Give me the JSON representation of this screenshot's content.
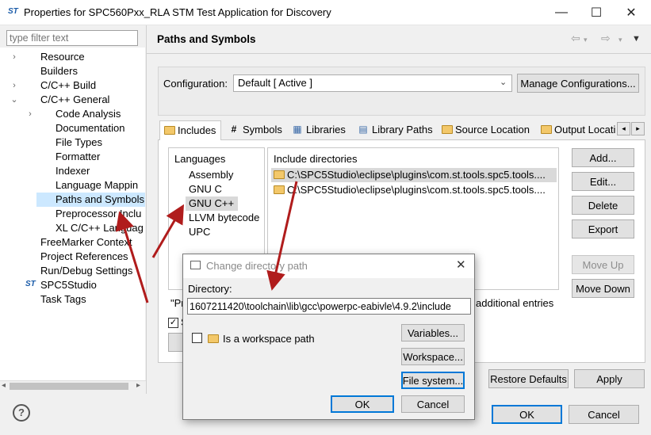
{
  "window": {
    "icon_text": "ST",
    "title": "Properties for SPC560Pxx_RLA STM Test Application for Discovery",
    "minimize": "—",
    "maximize": "☐",
    "close": "✕"
  },
  "filter": {
    "placeholder": "type filter text"
  },
  "nav": {
    "items": [
      {
        "label": "Resource"
      },
      {
        "label": "Builders"
      },
      {
        "label": "C/C++ Build"
      },
      {
        "label": "C/C++ General"
      },
      {
        "label": "Code Analysis"
      },
      {
        "label": "Documentation"
      },
      {
        "label": "File Types"
      },
      {
        "label": "Formatter"
      },
      {
        "label": "Indexer"
      },
      {
        "label": "Language Mappin"
      },
      {
        "label": "Paths and Symbols"
      },
      {
        "label": "Preprocessor Inclu"
      },
      {
        "label": "XL C/C++ Languag"
      },
      {
        "label": "FreeMarker Context"
      },
      {
        "label": "Project References"
      },
      {
        "label": "Run/Debug Settings"
      },
      {
        "label": "SPC5Studio"
      },
      {
        "label": "Task Tags"
      }
    ],
    "selected": "Paths and Symbols"
  },
  "page": {
    "title": "Paths and Symbols",
    "config_label": "Configuration:",
    "config_value": "Default  [ Active ]",
    "manage_button": "Manage Configurations..."
  },
  "tabs": [
    {
      "label": "Includes",
      "icon": "includes-icon"
    },
    {
      "label": "Symbols",
      "icon": "hash-icon"
    },
    {
      "label": "Libraries",
      "icon": "libraries-icon"
    },
    {
      "label": "Library Paths",
      "icon": "library-paths-icon"
    },
    {
      "label": "Source Location",
      "icon": "source-folder-icon"
    },
    {
      "label": "Output Locati",
      "icon": "output-folder-icon"
    }
  ],
  "languages": {
    "header": "Languages",
    "items": [
      "Assembly",
      "GNU C",
      "GNU C++",
      "LLVM bytecode",
      "UPC"
    ],
    "selected": "GNU C++"
  },
  "include_dirs": {
    "header": "Include directories",
    "items": [
      "C:\\SPC5Studio\\eclipse\\plugins\\com.st.tools.spc5.tools....",
      "C:\\SPC5Studio\\eclipse\\plugins\\com.st.tools.spc5.tools...."
    ]
  },
  "side_buttons": {
    "add": "Add...",
    "edit": "Edit...",
    "delete": "Delete",
    "export": "Export",
    "move_up": "Move Up",
    "move_down": "Move Down"
  },
  "partial": {
    "note_prefix": "\"Pr",
    "note_suffix": "additional entries",
    "checkbox_fragment": "S"
  },
  "page_buttons": {
    "restore": "Restore Defaults",
    "apply": "Apply"
  },
  "dialog_buttons": {
    "ok": "OK",
    "cancel": "Cancel"
  },
  "dialog": {
    "title": "Change directory path",
    "close": "✕",
    "directory_label": "Directory:",
    "directory_value": "1607211420\\toolchain\\lib\\gcc\\powerpc-eabivle\\4.9.2\\include",
    "workspace_checkbox": "Is a workspace path",
    "variables": "Variables...",
    "workspace": "Workspace...",
    "file_system": "File system...",
    "ok": "OK",
    "cancel": "Cancel"
  },
  "colors": {
    "selection": "#cce8ff",
    "annotation_arrow": "#b01c1c",
    "accent": "#0078d7"
  }
}
